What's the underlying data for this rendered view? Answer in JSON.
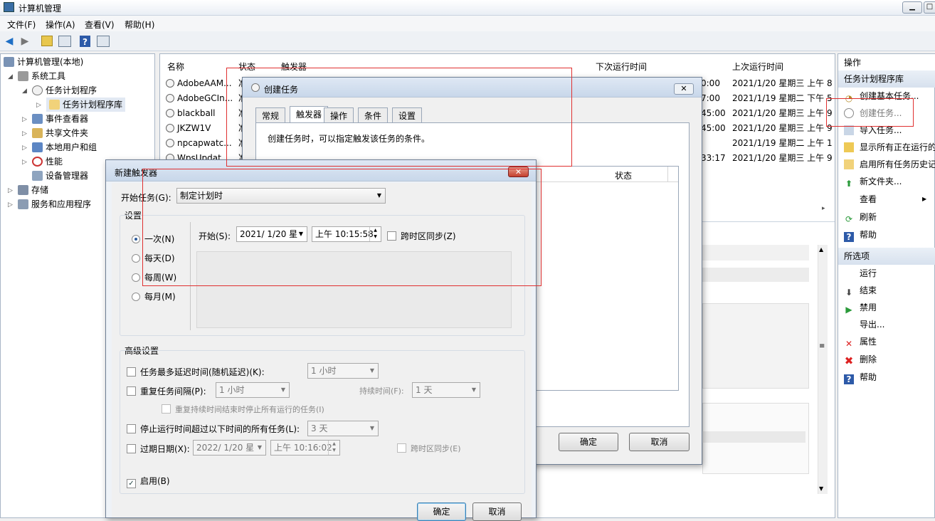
{
  "window": {
    "title": "计算机管理",
    "min": "▁",
    "max": "□"
  },
  "menu": [
    "文件(F)",
    "操作(A)",
    "查看(V)",
    "帮助(H)"
  ],
  "toolbar": {
    "back": "◀",
    "forward": "▶",
    "help": "?"
  },
  "tree": {
    "root": "计算机管理(本地)",
    "system_tools": "系统工具",
    "task_scheduler": "任务计划程序",
    "task_library": "任务计划程序库",
    "event_viewer": "事件查看器",
    "shared_folders": "共享文件夹",
    "local_users": "本地用户和组",
    "performance": "性能",
    "device_manager": "设备管理器",
    "storage": "存储",
    "services_apps": "服务和应用程序"
  },
  "center": {
    "columns": {
      "name": "名称",
      "status": "状态",
      "trigger": "触发器",
      "next_run": "下次运行时间",
      "last_run": "上次运行时间"
    },
    "rows": [
      {
        "name": "AdobeAAM...",
        "status": "准",
        "next": "0:00",
        "last": "2021/1/20 星期三 上午 8"
      },
      {
        "name": "AdobeGCIn...",
        "status": "准",
        "next": "7:00",
        "last": "2021/1/19 星期二 下午 5"
      },
      {
        "name": "blackball",
        "status": "准",
        "next": "45:00",
        "last": "2021/1/20 星期三 上午 9"
      },
      {
        "name": "JKZW1V",
        "status": "准",
        "next": "45:00",
        "last": "2021/1/20 星期三 上午 9"
      },
      {
        "name": "npcapwatc...",
        "status": "准",
        "next": "",
        "last": "2021/1/19 星期二 上午 1"
      },
      {
        "name": "WpsUpdat...",
        "status": "准",
        "next": "33:17",
        "last": "2021/1/20 星期三 上午 9"
      }
    ]
  },
  "actions": {
    "header": "操作",
    "section1": "任务计划程序库",
    "items1": [
      "创建基本任务...",
      "创建任务...",
      "导入任务...",
      "显示所有正在运行的",
      "启用所有任务历史记",
      "新文件夹...",
      "查看",
      "刷新",
      "帮助"
    ],
    "section2": "所选项",
    "items2": [
      "运行",
      "结束",
      "禁用",
      "导出...",
      "属性",
      "删除",
      "帮助"
    ]
  },
  "create_task": {
    "title": "创建任务",
    "tabs": [
      "常规",
      "触发器",
      "操作",
      "条件",
      "设置"
    ],
    "description": "创建任务时，可以指定触发该任务的条件。",
    "status_col": "状态",
    "ok": "确定",
    "cancel": "取消"
  },
  "new_trigger": {
    "title": "新建触发器",
    "begin_label": "开始任务(G):",
    "begin_value": "制定计划时",
    "settings_label": "设置",
    "schedules": [
      "一次(N)",
      "每天(D)",
      "每周(W)",
      "每月(M)"
    ],
    "start_label": "开始(S):",
    "start_date": "2021/ 1/20 星",
    "start_time": "上午 10:15:58",
    "sync_tz": "跨时区同步(Z)",
    "advanced_label": "高级设置",
    "delay_label": "任务最多延迟时间(随机延迟)(K):",
    "delay_value": "1 小时",
    "repeat_label": "重复任务间隔(P):",
    "repeat_value": "1 小时",
    "duration_label": "持续时间(F):",
    "duration_value": "1 天",
    "stop_repeat_label": "重复持续时间结束时停止所有运行的任务(I)",
    "stop_label": "停止运行时间超过以下时间的所有任务(L):",
    "stop_value": "3 天",
    "expire_label": "过期日期(X):",
    "expire_date": "2022/  1/20 星",
    "expire_time": "上午 10:16:02",
    "expire_sync": "跨时区同步(E)",
    "enabled_label": "启用(B)",
    "ok": "确定",
    "cancel": "取消"
  }
}
